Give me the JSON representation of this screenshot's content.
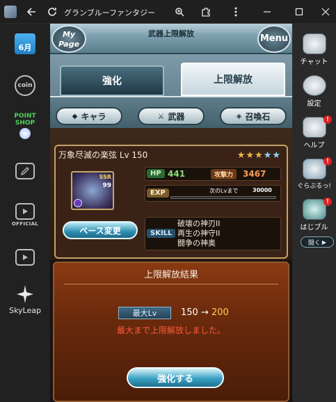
{
  "window": {
    "title": "グランブルーファンタジー"
  },
  "left_sidebar": {
    "calendar_label": "6月",
    "coin_label": "coin",
    "point_shop_label": "POINT SHOP",
    "official_label": "OFFICIAL",
    "skyleap_label": "SkyLeap"
  },
  "game": {
    "header_title": "武器上限解放",
    "mypage_label": "My Page",
    "menu_label": "Menu",
    "tabs": [
      {
        "label": "強化",
        "active": false
      },
      {
        "label": "上限解放",
        "active": true
      }
    ],
    "subtabs": [
      {
        "label": "キャラ"
      },
      {
        "label": "武器"
      },
      {
        "label": "召喚石"
      }
    ],
    "weapon": {
      "name": "万象尽滅の楽弦 Lv 150",
      "rarity": "SSR",
      "plus": "99",
      "hp_label": "HP",
      "hp_value": "441",
      "atk_label": "攻撃力",
      "atk_value": "3467",
      "exp_label": "EXP",
      "next_lv_label": "次のLvまで",
      "next_lv_value": "30000",
      "skill_label": "SKILL",
      "skills": [
        "破壊の神刃II",
        "再生の神守II",
        "闘争の神奥"
      ],
      "base_change_label": "ベース変更",
      "stars_filled": 3,
      "stars_total": 5
    },
    "result": {
      "title": "上限解放結果",
      "max_lv_label": "最大Lv",
      "max_lv_old": "150",
      "arrow": "→",
      "max_lv_new": "200",
      "message": "最大まで上限解放しました。",
      "enhance_button": "強化する"
    }
  },
  "right_sidebar": {
    "items": [
      {
        "label": "チャット",
        "badge": ""
      },
      {
        "label": "設定",
        "badge": ""
      },
      {
        "label": "ヘルプ",
        "badge": "!"
      },
      {
        "label": "ぐらぶるっ!",
        "badge": "!"
      },
      {
        "label": "はじブル",
        "badge": "!"
      }
    ],
    "open_label": "開く"
  },
  "colors": {
    "titlebar": "#1f1f1f",
    "accent_teal": "#2e8db0",
    "panel_brown": "#3a2316",
    "result_orange": "#8a3a12",
    "message_red": "#ff5a3a",
    "new_value_gold": "#ffcf4d"
  }
}
